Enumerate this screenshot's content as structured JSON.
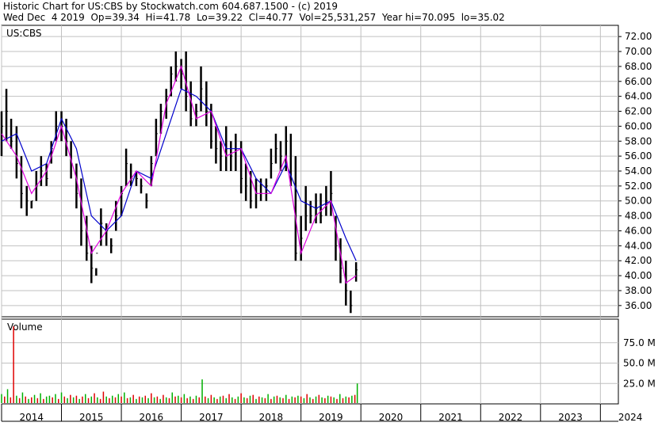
{
  "header": {
    "line1": "Historic Chart for US:CBS by Stockwatch.com 604.687.1500 - (c) 2019",
    "line2": "Wed Dec  4 2019  Op=39.34  Hi=41.78  Lo=39.22  Cl=40.77  Vol=25,531,257  Year hi=70.095  lo=35.02"
  },
  "colors": {
    "price_bars": "#000000",
    "short_ma": "#e000e0",
    "long_ma": "#0000cc",
    "volume_up": "#00b000",
    "volume_down": "#e00000",
    "grid": "#c0c0c0"
  },
  "chart_data": [
    {
      "type": "line",
      "title": "US:CBS",
      "xlabel": "",
      "ylabel": "",
      "ylim": [
        34.5,
        73.5
      ],
      "y_ticks": [
        "72.00",
        "70.00",
        "68.00",
        "66.00",
        "64.00",
        "62.00",
        "60.00",
        "58.00",
        "56.00",
        "54.00",
        "52.00",
        "50.00",
        "48.00",
        "46.00",
        "44.00",
        "42.00",
        "40.00",
        "38.00",
        "36.00"
      ],
      "x_ticks": [
        "2014",
        "2015",
        "2016",
        "2017",
        "2018",
        "2019",
        "2020",
        "2021",
        "2022",
        "2023",
        "2024"
      ],
      "grid": true,
      "series": [
        {
          "kind": "price",
          "x": [
            2014.0,
            2014.08,
            2014.16,
            2014.25,
            2014.33,
            2014.42,
            2014.5,
            2014.58,
            2014.66,
            2014.75,
            2014.83,
            2014.91,
            2015.0,
            2015.08,
            2015.16,
            2015.25,
            2015.33,
            2015.42,
            2015.5,
            2015.58,
            2015.66,
            2015.75,
            2015.83,
            2015.91,
            2016.0,
            2016.08,
            2016.16,
            2016.25,
            2016.33,
            2016.42,
            2016.5,
            2016.58,
            2016.66,
            2016.75,
            2016.83,
            2016.91,
            2017.0,
            2017.08,
            2017.16,
            2017.25,
            2017.33,
            2017.42,
            2017.5,
            2017.58,
            2017.66,
            2017.75,
            2017.83,
            2017.91,
            2018.0,
            2018.08,
            2018.16,
            2018.25,
            2018.33,
            2018.42,
            2018.5,
            2018.58,
            2018.66,
            2018.75,
            2018.83,
            2018.91,
            2019.0,
            2019.08,
            2019.16,
            2019.25,
            2019.33,
            2019.42,
            2019.5,
            2019.58,
            2019.66,
            2019.75,
            2019.83,
            2019.92
          ],
          "high": [
            62,
            65,
            61,
            60,
            56,
            52,
            50,
            54,
            56,
            55,
            58,
            62,
            62,
            61,
            58,
            55,
            53,
            48,
            44,
            41,
            49,
            47,
            45,
            50,
            52,
            57,
            55,
            54,
            53,
            51,
            56,
            61,
            63,
            65,
            68,
            70,
            69,
            70,
            66,
            63,
            68,
            66,
            63,
            60,
            58,
            60,
            58,
            59,
            58,
            55,
            54,
            53,
            53,
            53,
            57,
            59,
            58,
            60,
            59,
            56,
            48,
            52,
            50,
            51,
            51,
            52,
            54,
            48,
            45,
            42,
            38,
            41.8
          ],
          "low": [
            56,
            58,
            57,
            53,
            49,
            48,
            49,
            50,
            52,
            52,
            55,
            58,
            58,
            56,
            53,
            49,
            44,
            42,
            39,
            40,
            44,
            44,
            43,
            46,
            48,
            52,
            52,
            52,
            51,
            49,
            52,
            56,
            59,
            61,
            64,
            66,
            65,
            62,
            60,
            60,
            62,
            60,
            57,
            55,
            54,
            54,
            54,
            54,
            51,
            50,
            49,
            49,
            50,
            50,
            53,
            55,
            54,
            54,
            52,
            42,
            42,
            46,
            47,
            47,
            47,
            48,
            48,
            42,
            39,
            36,
            35,
            39.2
          ],
          "close": [
            60,
            62,
            58,
            55,
            51,
            50,
            50,
            52,
            54,
            53,
            57,
            60,
            60,
            58,
            55,
            51,
            46,
            43,
            41,
            43,
            47,
            46,
            44,
            48,
            51,
            55,
            53,
            53,
            52,
            50,
            55,
            59,
            62,
            64,
            67,
            68,
            67,
            64,
            61,
            62,
            65,
            62,
            58,
            57,
            56,
            57,
            56,
            57,
            53,
            52,
            50,
            51,
            51,
            52,
            55,
            57,
            56,
            58,
            53,
            43,
            45,
            48,
            48,
            49,
            48,
            50,
            51,
            44,
            41,
            38,
            36,
            40.77
          ]
        },
        {
          "kind": "short_ma",
          "x": [
            2014.0,
            2014.25,
            2014.5,
            2014.75,
            2015.0,
            2015.25,
            2015.5,
            2015.75,
            2016.0,
            2016.25,
            2016.5,
            2016.75,
            2017.0,
            2017.25,
            2017.5,
            2017.75,
            2018.0,
            2018.25,
            2018.5,
            2018.75,
            2019.0,
            2019.25,
            2019.5,
            2019.75,
            2019.92
          ],
          "values": [
            59,
            56,
            51,
            54,
            60,
            53,
            43,
            46,
            51,
            54,
            52,
            63,
            68,
            61,
            62,
            56,
            57,
            51,
            51,
            56,
            43,
            48,
            50,
            39,
            40
          ]
        },
        {
          "kind": "long_ma",
          "x": [
            2014.0,
            2014.25,
            2014.5,
            2014.75,
            2015.0,
            2015.25,
            2015.5,
            2015.75,
            2016.0,
            2016.25,
            2016.5,
            2016.75,
            2017.0,
            2017.25,
            2017.5,
            2017.75,
            2018.0,
            2018.25,
            2018.5,
            2018.75,
            2019.0,
            2019.25,
            2019.5,
            2019.75,
            2019.92
          ],
          "values": [
            58,
            59,
            54,
            55,
            61,
            57,
            48,
            46,
            48,
            54,
            53,
            59,
            65,
            64,
            62,
            57,
            57,
            53,
            51,
            55,
            50,
            49,
            50,
            45,
            42
          ]
        }
      ]
    },
    {
      "type": "bar",
      "title": "Volume",
      "ylim": [
        0,
        100
      ],
      "y_ticks": [
        "75.0 M",
        "50.0 M",
        "25.0 M"
      ],
      "unit": "M",
      "grid": true,
      "series": [
        {
          "name": "",
          "x": [
            2014.0,
            2014.05,
            2014.1,
            2014.15,
            2014.2,
            2014.25,
            2014.3,
            2014.35,
            2014.4,
            2014.45,
            2014.5,
            2014.55,
            2014.6,
            2014.65,
            2014.7,
            2014.75,
            2014.8,
            2014.85,
            2014.9,
            2014.95,
            2015.0,
            2015.05,
            2015.1,
            2015.15,
            2015.2,
            2015.25,
            2015.3,
            2015.35,
            2015.4,
            2015.45,
            2015.5,
            2015.55,
            2015.6,
            2015.65,
            2015.7,
            2015.75,
            2015.8,
            2015.85,
            2015.9,
            2015.95,
            2016.0,
            2016.05,
            2016.1,
            2016.15,
            2016.2,
            2016.25,
            2016.3,
            2016.35,
            2016.4,
            2016.45,
            2016.5,
            2016.55,
            2016.6,
            2016.65,
            2016.7,
            2016.75,
            2016.8,
            2016.85,
            2016.9,
            2016.95,
            2017.0,
            2017.05,
            2017.1,
            2017.15,
            2017.2,
            2017.25,
            2017.3,
            2017.35,
            2017.4,
            2017.45,
            2017.5,
            2017.55,
            2017.6,
            2017.65,
            2017.7,
            2017.75,
            2017.8,
            2017.85,
            2017.9,
            2017.95,
            2018.0,
            2018.05,
            2018.1,
            2018.15,
            2018.2,
            2018.25,
            2018.3,
            2018.35,
            2018.4,
            2018.45,
            2018.5,
            2018.55,
            2018.6,
            2018.65,
            2018.7,
            2018.75,
            2018.8,
            2018.85,
            2018.9,
            2018.95,
            2019.0,
            2019.05,
            2019.1,
            2019.15,
            2019.2,
            2019.25,
            2019.3,
            2019.35,
            2019.4,
            2019.45,
            2019.5,
            2019.55,
            2019.6,
            2019.65,
            2019.7,
            2019.75,
            2019.8,
            2019.85,
            2019.9,
            2019.94
          ],
          "values": [
            12,
            9,
            18,
            8,
            95,
            10,
            7,
            14,
            9,
            6,
            8,
            11,
            7,
            13,
            6,
            9,
            10,
            8,
            12,
            6,
            14,
            9,
            7,
            11,
            8,
            10,
            6,
            9,
            12,
            7,
            9,
            13,
            8,
            6,
            15,
            9,
            7,
            10,
            8,
            12,
            9,
            14,
            7,
            8,
            11,
            6,
            9,
            8,
            10,
            7,
            13,
            8,
            9,
            6,
            11,
            8,
            7,
            14,
            9,
            10,
            8,
            12,
            7,
            9,
            6,
            10,
            8,
            30,
            9,
            7,
            11,
            8,
            6,
            9,
            10,
            7,
            12,
            8,
            6,
            9,
            13,
            8,
            7,
            10,
            11,
            6,
            9,
            8,
            7,
            12,
            6,
            9,
            10,
            8,
            7,
            11,
            6,
            9,
            8,
            10,
            9,
            7,
            12,
            8,
            6,
            9,
            11,
            8,
            7,
            10,
            9,
            8,
            6,
            12,
            7,
            9,
            8,
            10,
            11,
            25
          ],
          "up": [
            true,
            false,
            true,
            false,
            false,
            true,
            false,
            true,
            false,
            true,
            false,
            true,
            false,
            true,
            false,
            true,
            true,
            false,
            true,
            false,
            true,
            false,
            true,
            false,
            true,
            false,
            true,
            false,
            true,
            false,
            true,
            false,
            true,
            false,
            false,
            true,
            false,
            true,
            false,
            true,
            false,
            true,
            false,
            true,
            false,
            true,
            false,
            true,
            false,
            true,
            false,
            true,
            false,
            true,
            false,
            true,
            false,
            true,
            false,
            true,
            false,
            true,
            false,
            true,
            false,
            true,
            false,
            true,
            false,
            true,
            false,
            true,
            false,
            true,
            false,
            true,
            false,
            true,
            false,
            true,
            false,
            true,
            false,
            true,
            false,
            true,
            false,
            true,
            false,
            true,
            false,
            true,
            false,
            true,
            false,
            true,
            false,
            true,
            false,
            true,
            false,
            true,
            false,
            true,
            false,
            true,
            false,
            true,
            false,
            true,
            false,
            true,
            false,
            true,
            false,
            true,
            false,
            true,
            false,
            true
          ]
        }
      ]
    }
  ]
}
